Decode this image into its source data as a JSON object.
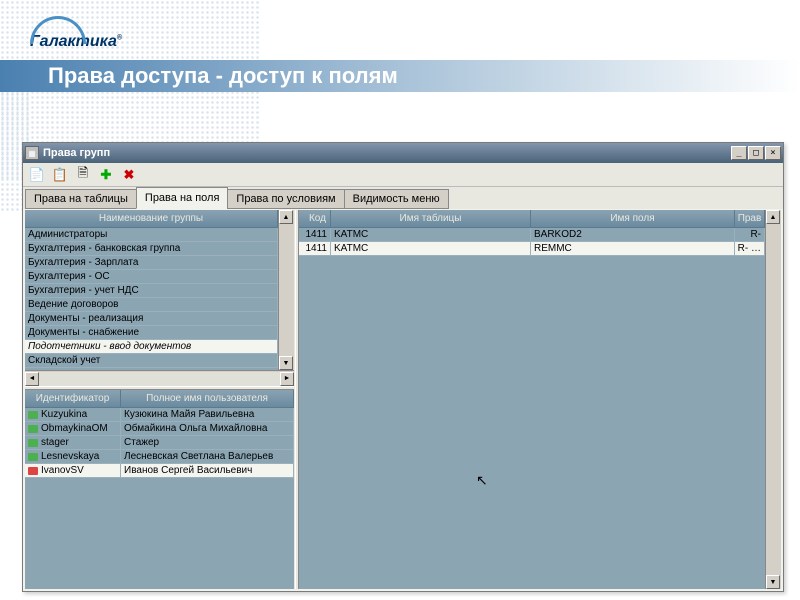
{
  "brand": "Галактика",
  "page_title": "Права доступа - доступ к полям",
  "window": {
    "title": "Права групп"
  },
  "tabs": {
    "t1": "Права на таблицы",
    "t2": "Права на поля",
    "t3": "Права по условиям",
    "t4": "Видимость меню"
  },
  "headers": {
    "group_name": "Наименование группы",
    "code": "Код",
    "table_name": "Имя таблицы",
    "field_name": "Имя поля",
    "rights": "Прав",
    "identifier": "Идентификатор",
    "full_user_name": "Полное имя пользователя"
  },
  "groups": {
    "r0": "Администраторы",
    "r1": "Бухгалтерия - банковская группа",
    "r2": "Бухгалтерия - Зарплата",
    "r3": "Бухгалтерия - ОС",
    "r4": "Бухгалтерия - учет НДС",
    "r5": "Ведение договоров",
    "r6": "Документы - реализация",
    "r7": "Документы - снабжение",
    "r8": "Подотчетники - ввод документов",
    "r9": "Складской учет"
  },
  "users": {
    "u0": {
      "id": "Kuzyukina",
      "name": "Кузюкина Майя Равильевна"
    },
    "u1": {
      "id": "ObmaykinaOM",
      "name": "Обмайкина Ольга Михайловна"
    },
    "u2": {
      "id": "stager",
      "name": "Стажер"
    },
    "u3": {
      "id": "Lesnevskaya",
      "name": "Лесневская Светлана Валерьев"
    },
    "u4": {
      "id": "IvanovSV",
      "name": "Иванов Сергей Васильевич"
    }
  },
  "fields": {
    "f0": {
      "code": "1411",
      "table": "KATMC",
      "field": "BARKOD2",
      "rights": "R-"
    },
    "f1": {
      "code": "1411",
      "table": "KATMC",
      "field": "REMMC",
      "rights": "R- …"
    }
  }
}
